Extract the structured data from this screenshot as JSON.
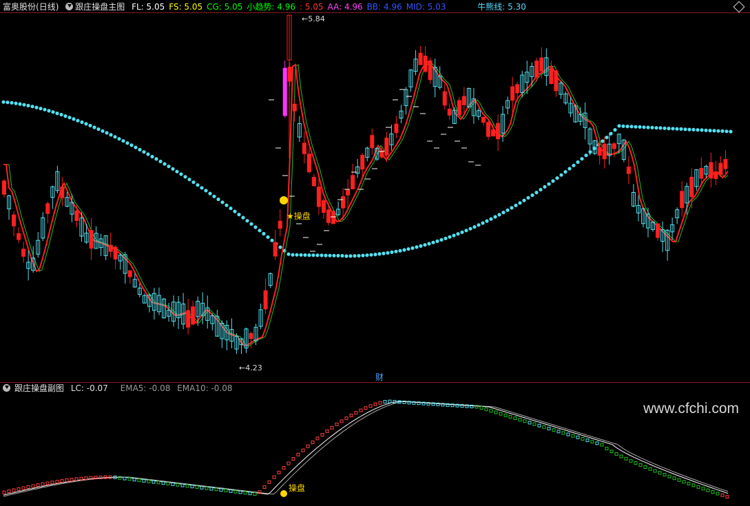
{
  "stock": {
    "name": "富奥股份",
    "period": "(日线)"
  },
  "main_indicator": {
    "name": "跟庄操盘主图",
    "values": [
      {
        "label": "FL: 5.05",
        "color": "#ffffff"
      },
      {
        "label": "FS: 5.05",
        "color": "#ffff00"
      },
      {
        "label": "CG: 5.05",
        "color": "#00ff00"
      },
      {
        "label": "小趋势: 4.96",
        "color": "#00ff00"
      },
      {
        "label": ": 5.05",
        "color": "#ff3030"
      },
      {
        "label": "AA: 4.96",
        "color": "#ff44ff"
      },
      {
        "label": "BB: 4.96",
        "color": "#3355ff"
      },
      {
        "label": "MID: 5.03",
        "color": "#3355ff"
      }
    ],
    "bull_bear": {
      "label": "牛熊线: 5.30",
      "color": "#55ddff"
    }
  },
  "sub_indicator": {
    "name": "跟庄操盘副图",
    "lc": "LC: -0.07",
    "ema5": "EMA5: -0.08",
    "ema10": "EMA10: -0.08"
  },
  "annotations": {
    "high_price": "5.84",
    "low_price": "4.23",
    "signal_label": "★操盘",
    "sub_signal_label": "操盘",
    "finance_marker": "财",
    "money_bag_icon": "money-bag"
  },
  "watermark": "www.cfchi.com",
  "colors": {
    "up": "#ff2020",
    "down": "#55e0f0",
    "bull_bear_line": "#55e0f0",
    "trend_line": "#ff2020",
    "ma_green": "#20c020",
    "border": "#8b1a1a",
    "magenta": "#ff33ff",
    "gold": "#ffd700"
  },
  "chart_data": {
    "type": "candlestick",
    "price_range": [
      4.23,
      5.84
    ],
    "high": 5.84,
    "low": 4.23
  }
}
